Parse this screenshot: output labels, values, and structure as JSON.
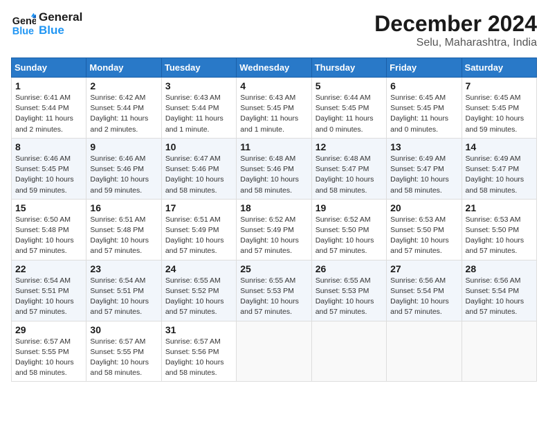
{
  "header": {
    "logo_line1": "General",
    "logo_line2": "Blue",
    "title": "December 2024",
    "subtitle": "Selu, Maharashtra, India"
  },
  "columns": [
    "Sunday",
    "Monday",
    "Tuesday",
    "Wednesday",
    "Thursday",
    "Friday",
    "Saturday"
  ],
  "weeks": [
    [
      {
        "day": "1",
        "info": "Sunrise: 6:41 AM\nSunset: 5:44 PM\nDaylight: 11 hours\nand 2 minutes."
      },
      {
        "day": "2",
        "info": "Sunrise: 6:42 AM\nSunset: 5:44 PM\nDaylight: 11 hours\nand 2 minutes."
      },
      {
        "day": "3",
        "info": "Sunrise: 6:43 AM\nSunset: 5:44 PM\nDaylight: 11 hours\nand 1 minute."
      },
      {
        "day": "4",
        "info": "Sunrise: 6:43 AM\nSunset: 5:45 PM\nDaylight: 11 hours\nand 1 minute."
      },
      {
        "day": "5",
        "info": "Sunrise: 6:44 AM\nSunset: 5:45 PM\nDaylight: 11 hours\nand 0 minutes."
      },
      {
        "day": "6",
        "info": "Sunrise: 6:45 AM\nSunset: 5:45 PM\nDaylight: 11 hours\nand 0 minutes."
      },
      {
        "day": "7",
        "info": "Sunrise: 6:45 AM\nSunset: 5:45 PM\nDaylight: 10 hours\nand 59 minutes."
      }
    ],
    [
      {
        "day": "8",
        "info": "Sunrise: 6:46 AM\nSunset: 5:45 PM\nDaylight: 10 hours\nand 59 minutes."
      },
      {
        "day": "9",
        "info": "Sunrise: 6:46 AM\nSunset: 5:46 PM\nDaylight: 10 hours\nand 59 minutes."
      },
      {
        "day": "10",
        "info": "Sunrise: 6:47 AM\nSunset: 5:46 PM\nDaylight: 10 hours\nand 58 minutes."
      },
      {
        "day": "11",
        "info": "Sunrise: 6:48 AM\nSunset: 5:46 PM\nDaylight: 10 hours\nand 58 minutes."
      },
      {
        "day": "12",
        "info": "Sunrise: 6:48 AM\nSunset: 5:47 PM\nDaylight: 10 hours\nand 58 minutes."
      },
      {
        "day": "13",
        "info": "Sunrise: 6:49 AM\nSunset: 5:47 PM\nDaylight: 10 hours\nand 58 minutes."
      },
      {
        "day": "14",
        "info": "Sunrise: 6:49 AM\nSunset: 5:47 PM\nDaylight: 10 hours\nand 58 minutes."
      }
    ],
    [
      {
        "day": "15",
        "info": "Sunrise: 6:50 AM\nSunset: 5:48 PM\nDaylight: 10 hours\nand 57 minutes."
      },
      {
        "day": "16",
        "info": "Sunrise: 6:51 AM\nSunset: 5:48 PM\nDaylight: 10 hours\nand 57 minutes."
      },
      {
        "day": "17",
        "info": "Sunrise: 6:51 AM\nSunset: 5:49 PM\nDaylight: 10 hours\nand 57 minutes."
      },
      {
        "day": "18",
        "info": "Sunrise: 6:52 AM\nSunset: 5:49 PM\nDaylight: 10 hours\nand 57 minutes."
      },
      {
        "day": "19",
        "info": "Sunrise: 6:52 AM\nSunset: 5:50 PM\nDaylight: 10 hours\nand 57 minutes."
      },
      {
        "day": "20",
        "info": "Sunrise: 6:53 AM\nSunset: 5:50 PM\nDaylight: 10 hours\nand 57 minutes."
      },
      {
        "day": "21",
        "info": "Sunrise: 6:53 AM\nSunset: 5:50 PM\nDaylight: 10 hours\nand 57 minutes."
      }
    ],
    [
      {
        "day": "22",
        "info": "Sunrise: 6:54 AM\nSunset: 5:51 PM\nDaylight: 10 hours\nand 57 minutes."
      },
      {
        "day": "23",
        "info": "Sunrise: 6:54 AM\nSunset: 5:51 PM\nDaylight: 10 hours\nand 57 minutes."
      },
      {
        "day": "24",
        "info": "Sunrise: 6:55 AM\nSunset: 5:52 PM\nDaylight: 10 hours\nand 57 minutes."
      },
      {
        "day": "25",
        "info": "Sunrise: 6:55 AM\nSunset: 5:53 PM\nDaylight: 10 hours\nand 57 minutes."
      },
      {
        "day": "26",
        "info": "Sunrise: 6:55 AM\nSunset: 5:53 PM\nDaylight: 10 hours\nand 57 minutes."
      },
      {
        "day": "27",
        "info": "Sunrise: 6:56 AM\nSunset: 5:54 PM\nDaylight: 10 hours\nand 57 minutes."
      },
      {
        "day": "28",
        "info": "Sunrise: 6:56 AM\nSunset: 5:54 PM\nDaylight: 10 hours\nand 57 minutes."
      }
    ],
    [
      {
        "day": "29",
        "info": "Sunrise: 6:57 AM\nSunset: 5:55 PM\nDaylight: 10 hours\nand 58 minutes."
      },
      {
        "day": "30",
        "info": "Sunrise: 6:57 AM\nSunset: 5:55 PM\nDaylight: 10 hours\nand 58 minutes."
      },
      {
        "day": "31",
        "info": "Sunrise: 6:57 AM\nSunset: 5:56 PM\nDaylight: 10 hours\nand 58 minutes."
      },
      {
        "day": "",
        "info": ""
      },
      {
        "day": "",
        "info": ""
      },
      {
        "day": "",
        "info": ""
      },
      {
        "day": "",
        "info": ""
      }
    ]
  ]
}
